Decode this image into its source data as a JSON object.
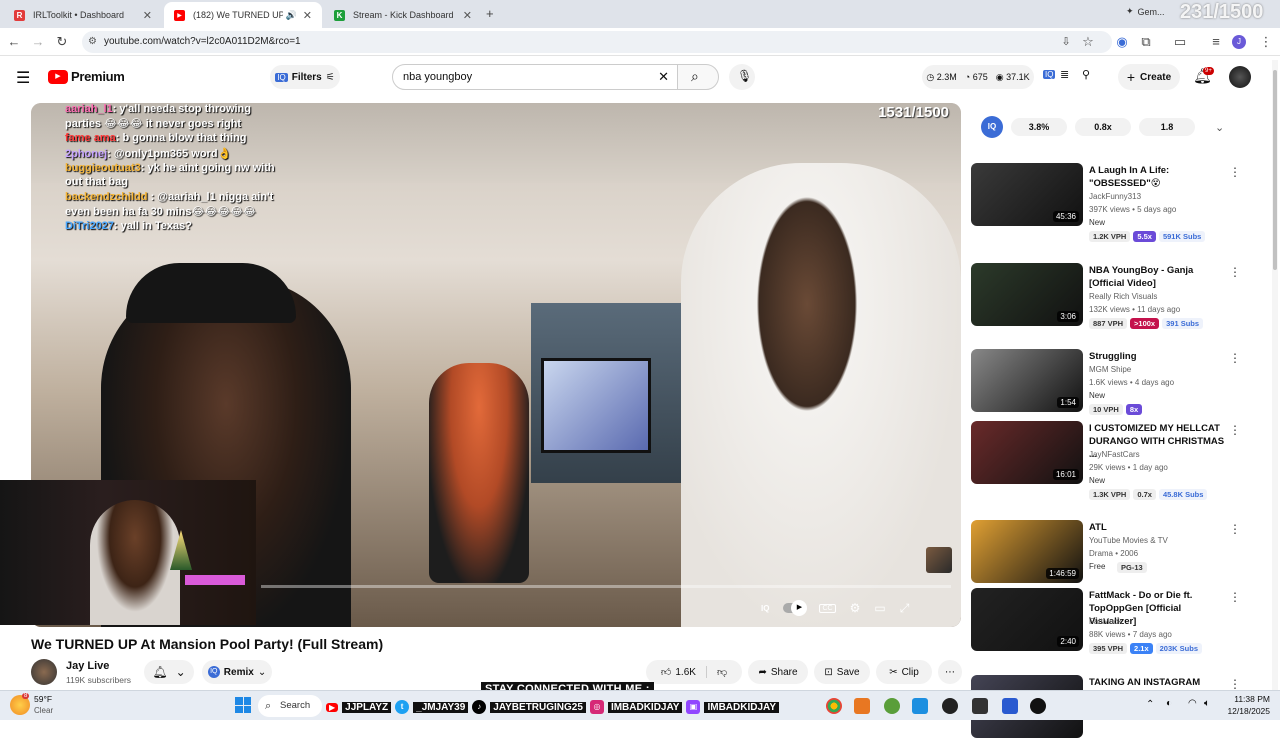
{
  "tabs": [
    {
      "title": "IRLToolkit • Dashboard",
      "fav_color": "#e23b3b",
      "fav_char": "R"
    },
    {
      "title": "(182) We TURNED UP At Ma",
      "fav_color": "#ff0000",
      "fav_char": "▶"
    },
    {
      "title": "Stream - Kick Dashboard",
      "fav_color": "#1d9e3a",
      "fav_char": "K"
    }
  ],
  "profile_chip": "Gem...",
  "corner_counter": "231/1500",
  "url": "youtube.com/watch?v=l2c0A011D2M&rco=1",
  "yt": {
    "logo": "Premium",
    "filters": "Filters",
    "search_value": "nba youngboy",
    "stats": [
      "2.3M",
      "675",
      "37.1K"
    ],
    "create": "Create",
    "notif_count": "9+"
  },
  "video": {
    "counter": "1531/1500",
    "chat": [
      {
        "user": "aariah_l1",
        "msg": ": y'all needa stop throwing",
        "ucolor": "#ff6db3"
      },
      {
        "user": "",
        "msg": "parties 😂😂😂 it never goes right",
        "ucolor": "#fff"
      },
      {
        "user": "fame ama",
        "msg": ": b gonna blow that thing",
        "ucolor": "#ff3a3a"
      },
      {
        "user": "2phonej",
        "msg": ": @only1pm365 word👌",
        "ucolor": "#c7a5ff"
      },
      {
        "user": "buggieoutuat3",
        "msg": ": yk he aint going nw with",
        "ucolor": "#f5b63a"
      },
      {
        "user": "",
        "msg": "out that bag",
        "ucolor": "#fff"
      },
      {
        "user": "backendzchildd",
        "msg": " : @aariah_l1 nigga ain't",
        "ucolor": "#f5b63a"
      },
      {
        "user": "",
        "msg": "even been ha fa 30 mins😂😂😂😂😂",
        "ucolor": "#fff"
      },
      {
        "user": "DiTri2027",
        "msg": ": yall in Texas?",
        "ucolor": "#4aa8ff"
      }
    ]
  },
  "title": "We TURNED UP At Mansion Pool Party! (Full Stream)",
  "channel": {
    "name": "Jay Live",
    "subs": "119K subscribers"
  },
  "remix": "Remix",
  "actions": {
    "likes": "1.6K",
    "share": "Share",
    "save": "Save",
    "clip": "Clip"
  },
  "overlay_banner": "STAY CONNECTED WITH ME :",
  "socials": [
    "JJPLAYZ",
    "_JMJAY39",
    "JAYBETRUGING25",
    "IMBADKIDJAY",
    "IMBADKIDJAY"
  ],
  "iq_panel": {
    "label": "IQ",
    "values": [
      "3.8%",
      "0.8x",
      "1.8"
    ]
  },
  "recs": [
    {
      "title": "A Laugh In A Life: \"OBSESSED\"😵",
      "channel": "JackFunny313",
      "meta": "397K views • 5 days ago",
      "tag": "New",
      "dur": "45:36",
      "b1": "1.2K VPH",
      "b2": "5.5x",
      "b3": "591K Subs",
      "b2c": "#6b4bd8",
      "thumb": "#3a3a3a"
    },
    {
      "title": "NBA YoungBoy - Ganja [Official Video]",
      "channel": "Really Rich Visuals",
      "meta": "132K views • 11 days ago",
      "tag": "",
      "dur": "3:06",
      "b1": "887 VPH",
      "b2": ">100x",
      "b3": "391 Subs",
      "b2c": "#c4124c",
      "thumb": "#2c3a2a"
    },
    {
      "title": "Struggling",
      "channel": "MGM Shipe",
      "meta": "1.6K views • 4 days ago",
      "tag": "New",
      "dur": "1:54",
      "b1": "10 VPH",
      "b2": "8x",
      "b3": "",
      "b2c": "#6b4bd8",
      "thumb": "#888"
    },
    {
      "title": "I CUSTOMIZED MY HELLCAT DURANGO WITH CHRISTMAS ...",
      "channel": "JayNFastCars",
      "meta": "29K views • 1 day ago",
      "tag": "New",
      "dur": "16:01",
      "b1": "1.3K VPH",
      "b2": "0.7x",
      "b3": "45.8K Subs",
      "b2c": "#eee",
      "thumb": "#6a2a2a"
    },
    {
      "title": "ATL",
      "channel": "YouTube Movies & TV",
      "meta": "Drama • 2006",
      "tag": "Free",
      "dur": "1:46:59",
      "b1": "",
      "b2": "PG-13",
      "b3": "",
      "b2c": "#eee",
      "thumb": "#e0a033"
    },
    {
      "title": "FattMack - Do or Die ft. TopOppGen [Official Visualizer]",
      "channel": "FattMack",
      "meta": "88K views • 7 days ago",
      "tag": "",
      "dur": "2:40",
      "b1": "395 VPH",
      "b2": "2.1x",
      "b3": "203K Subs",
      "b2c": "#3b82f6",
      "thumb": "#222"
    },
    {
      "title": "TAKING AN INSTAGRAM",
      "channel": "",
      "meta": "",
      "tag": "",
      "dur": "",
      "b1": "",
      "b2": "",
      "b3": "",
      "b2c": "#eee",
      "thumb": "#445"
    }
  ],
  "taskbar": {
    "weather_temp": "59°F",
    "weather_desc": "Clear",
    "search": "Search",
    "time": "11:38 PM",
    "date": "12/18/2025",
    "weather_badge": "8"
  }
}
